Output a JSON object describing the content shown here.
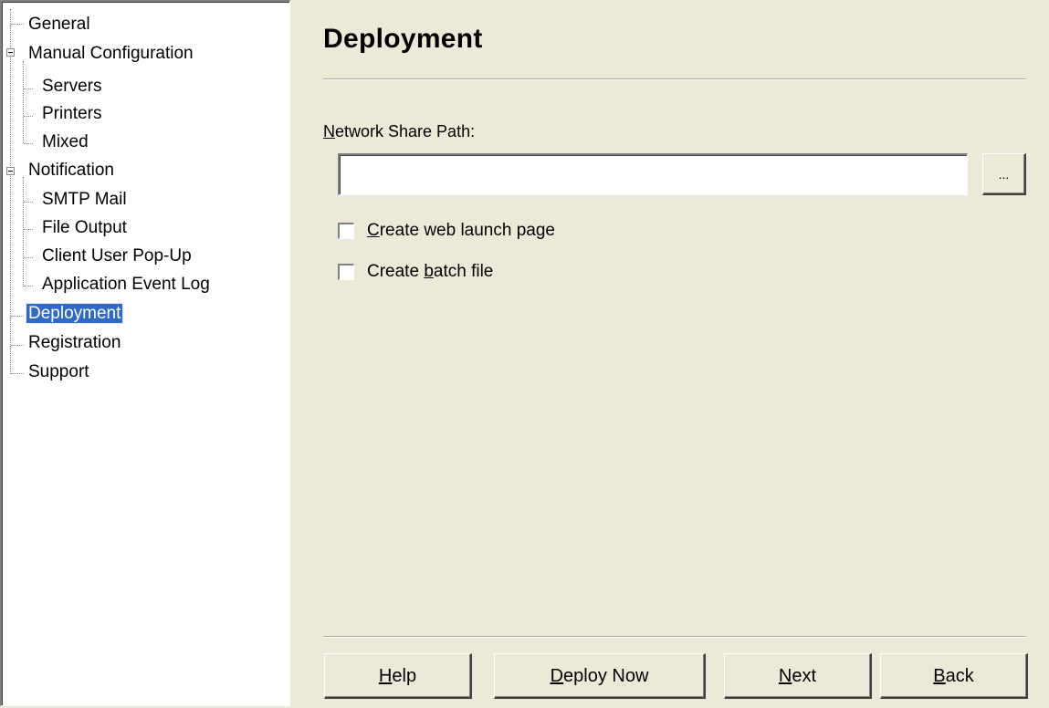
{
  "tree": {
    "items": [
      {
        "label": "General"
      },
      {
        "label": "Manual Configuration"
      },
      {
        "label": "Servers"
      },
      {
        "label": "Printers"
      },
      {
        "label": "Mixed"
      },
      {
        "label": "Notification"
      },
      {
        "label": "SMTP Mail"
      },
      {
        "label": "File Output"
      },
      {
        "label": "Client User Pop-Up"
      },
      {
        "label": "Application Event Log"
      },
      {
        "label": "Deployment"
      },
      {
        "label": "Registration"
      },
      {
        "label": "Support"
      }
    ],
    "selected": "Deployment"
  },
  "page": {
    "title": "Deployment",
    "share_label_accel": "N",
    "share_label_rest": "etwork Share Path:",
    "share_value": "",
    "browse_label": "...",
    "checkboxes": [
      {
        "pre": "",
        "accel": "C",
        "post": "reate web launch page",
        "checked": false
      },
      {
        "pre": "Create ",
        "accel": "b",
        "post": "atch file",
        "checked": false
      }
    ]
  },
  "buttons": {
    "help": {
      "accel": "H",
      "rest": "elp"
    },
    "deploy": {
      "accel": "D",
      "rest": "eploy Now"
    },
    "next": {
      "accel": "N",
      "rest": "ext"
    },
    "back": {
      "accel": "B",
      "rest": "ack"
    }
  }
}
